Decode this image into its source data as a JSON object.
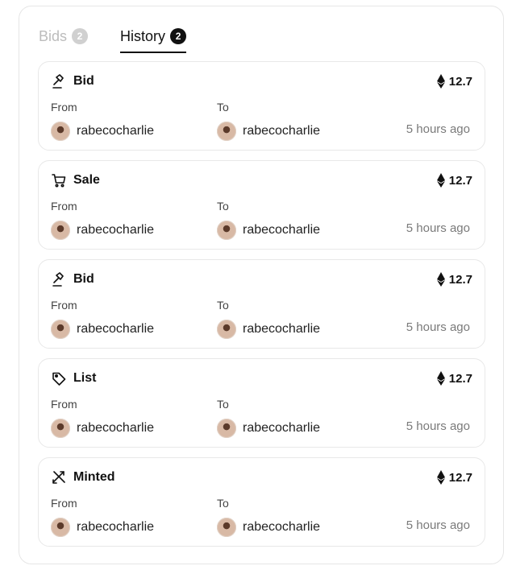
{
  "tabs": [
    {
      "label": "Bids",
      "count": "2"
    },
    {
      "label": "History",
      "count": "2"
    }
  ],
  "history": [
    {
      "type": "Bid",
      "icon": "gavel-icon",
      "price": "12.7",
      "from_label": "From",
      "to_label": "To",
      "from_user": "rabecocharlie",
      "to_user": "rabecocharlie",
      "time": "5 hours ago"
    },
    {
      "type": "Sale",
      "icon": "cart-icon",
      "price": "12.7",
      "from_label": "From",
      "to_label": "To",
      "from_user": "rabecocharlie",
      "to_user": "rabecocharlie",
      "time": "5 hours ago"
    },
    {
      "type": "Bid",
      "icon": "gavel-icon",
      "price": "12.7",
      "from_label": "From",
      "to_label": "To",
      "from_user": "rabecocharlie",
      "to_user": "rabecocharlie",
      "time": "5 hours ago"
    },
    {
      "type": "List",
      "icon": "tag-icon",
      "price": "12.7",
      "from_label": "From",
      "to_label": "To",
      "from_user": "rabecocharlie",
      "to_user": "rabecocharlie",
      "time": "5 hours ago"
    },
    {
      "type": "Minted",
      "icon": "minted-icon",
      "price": "12.7",
      "from_label": "From",
      "to_label": "To",
      "from_user": "rabecocharlie",
      "to_user": "rabecocharlie",
      "time": "5 hours ago"
    }
  ],
  "colors": {
    "text": "#111111",
    "muted": "#7a7a7a",
    "inactive_tab": "#bcbcbc",
    "border": "#e8e8e8"
  }
}
